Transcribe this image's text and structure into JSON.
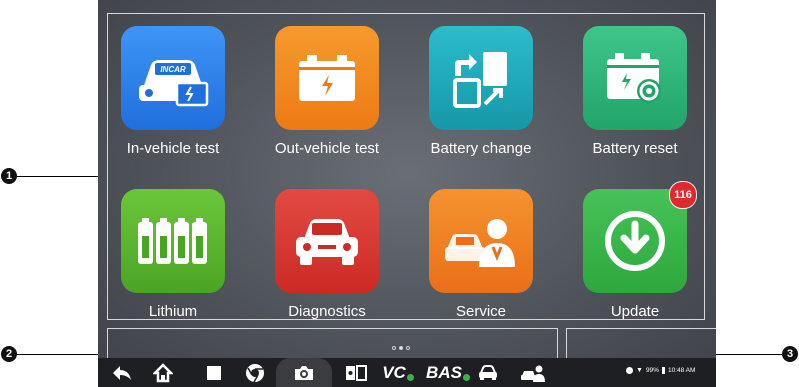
{
  "apps": [
    {
      "label": "In-vehicle test",
      "icon": "in-vehicle-test-icon",
      "color": "#2f86f0",
      "badge_text": "INCAR"
    },
    {
      "label": "Out-vehicle test",
      "icon": "battery-icon",
      "color": "#f2821e"
    },
    {
      "label": "Battery change",
      "icon": "battery-change-icon",
      "color": "#1eaab8"
    },
    {
      "label": "Battery reset",
      "icon": "battery-reset-icon",
      "color": "#2fb57a"
    },
    {
      "label": "Lithium",
      "icon": "lithium-cells-icon",
      "color": "#59b52f"
    },
    {
      "label": "Diagnostics",
      "icon": "car-front-icon",
      "color": "#dd3a34"
    },
    {
      "label": "Service",
      "icon": "service-technician-icon",
      "color": "#f07a1e"
    },
    {
      "label": "Update",
      "icon": "download-icon",
      "color": "#3cb54a",
      "notification_count": "116"
    }
  ],
  "taskbar": {
    "icons": [
      "back-icon",
      "home-icon",
      "recent-apps-icon",
      "chrome-icon",
      "camera-icon",
      "screen-mirror-icon",
      "vci-icon",
      "bas-icon",
      "car-icon",
      "service-icon"
    ],
    "vci_label": "VC",
    "bas_label": "BAS",
    "page_indicator": {
      "total": 3,
      "active": 1
    }
  },
  "status_bar": {
    "battery_percent": "99%",
    "time": "10:48 AM"
  },
  "callouts": [
    "1",
    "2",
    "3"
  ]
}
